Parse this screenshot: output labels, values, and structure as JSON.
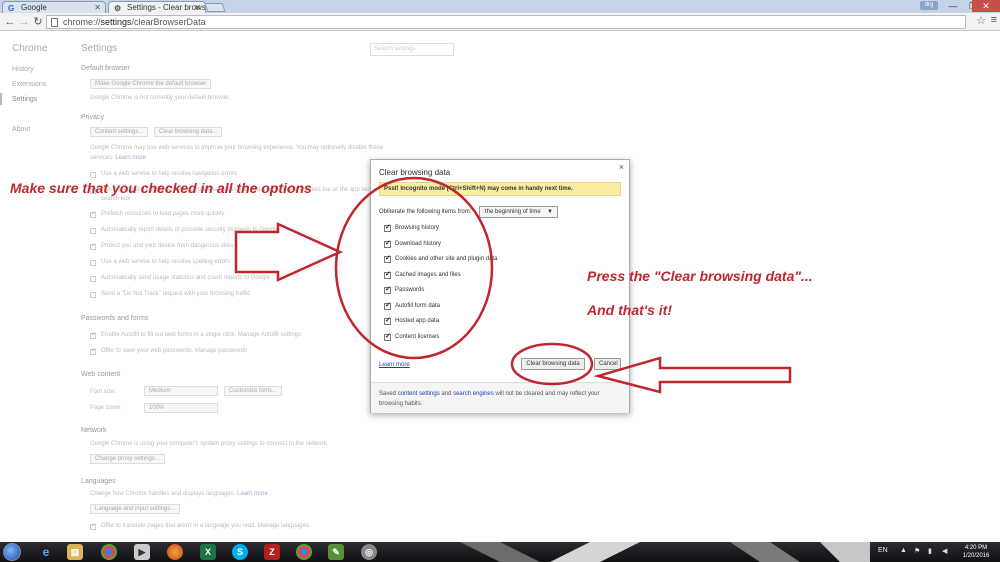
{
  "browser": {
    "tabs": [
      {
        "label": "Google",
        "icon": "G"
      },
      {
        "label": "Settings - Clear browsing",
        "icon": "gear"
      }
    ],
    "url_prefix": "chrome://",
    "url_settings": "settings",
    "url_suffix": "/clearBrowserData",
    "window_controls": {
      "minimize": "—",
      "maximize": "❐",
      "close": "✕"
    },
    "user_badge": "drg"
  },
  "settings_page": {
    "sidebar": {
      "title": "Chrome",
      "items": [
        "History",
        "Extensions",
        "Settings",
        "About"
      ]
    },
    "title": "Settings",
    "search_placeholder": "Search settings",
    "default_browser": {
      "heading": "Default browser",
      "button": "Make Google Chrome the default browser",
      "note": "Google Chrome is not currently your default browser."
    },
    "privacy": {
      "heading": "Privacy",
      "content_settings_button": "Content settings...",
      "clear_button": "Clear browsing data...",
      "desc_line1": "Google Chrome may use web services to improve your browsing experience. You may optionally disable these",
      "desc_line2": "services.",
      "learn_more": "Learn more",
      "options": [
        "Use a web service to help resolve navigation errors",
        "Use a prediction service to help complete searches and URLs typed in the address bar or the app launcher",
        "search box",
        "Prefetch resources to load pages more quickly",
        "Automatically report details of possible security incidents to Google",
        "Protect you and your device from dangerous sites",
        "Use a web service to help resolve spelling errors",
        "Automatically send usage statistics and crash reports to Google",
        "Send a \"Do Not Track\" request with your browsing traffic"
      ]
    },
    "passwords": {
      "heading": "Passwords and forms",
      "options": [
        "Enable Autofill to fill out web forms in a single click. Manage Autofill settings",
        "Offer to save your web passwords. Manage passwords"
      ]
    },
    "web_content": {
      "heading": "Web content",
      "font_size_label": "Font size:",
      "font_size_value": "Medium",
      "customize_button": "Customize fonts...",
      "zoom_label": "Page zoom:",
      "zoom_value": "100%"
    },
    "network": {
      "heading": "Network",
      "desc": "Google Chrome is using your computer's system proxy settings to connect to the network.",
      "button": "Change proxy settings..."
    },
    "languages": {
      "heading": "Languages",
      "desc": "Change how Chrome handles and displays languages.",
      "learn_more": "Learn more",
      "button": "Language and input settings...",
      "offer": "Offer to translate pages that aren't in a language you read. Manage languages"
    }
  },
  "dialog": {
    "title": "Clear browsing data",
    "close": "×",
    "banner": "Psst! Incognito mode (Ctrl+Shift+N) may come in handy next time.",
    "obliterate_label": "Obliterate the following items from:",
    "obliterate_value": "the beginning of time",
    "items": [
      "Browsing history",
      "Download history",
      "Cookies and other site and plugin data",
      "Cached images and files",
      "Passwords",
      "Autofill form data",
      "Hosted app data",
      "Content licenses"
    ],
    "learn_more": "Learn more",
    "clear_button": "Clear browsing data",
    "cancel_button": "Cancel",
    "footer_pre": "Saved ",
    "footer_link1": "content settings",
    "footer_mid": " and ",
    "footer_link2": "search engines",
    "footer_post": " will not be cleared and may reflect your browsing habits."
  },
  "annotations": {
    "left": "Make sure that you checked in all the options",
    "right1": "Press the \"Clear browsing data\"...",
    "right2": "And that's it!"
  },
  "taskbar": {
    "lang": "EN",
    "time": "4:20 PM",
    "date": "1/20/2016"
  },
  "colors": {
    "annotation_red": "#c0262e",
    "banner_yellow": "#f9eda0",
    "link_blue": "#1a3fb0"
  }
}
